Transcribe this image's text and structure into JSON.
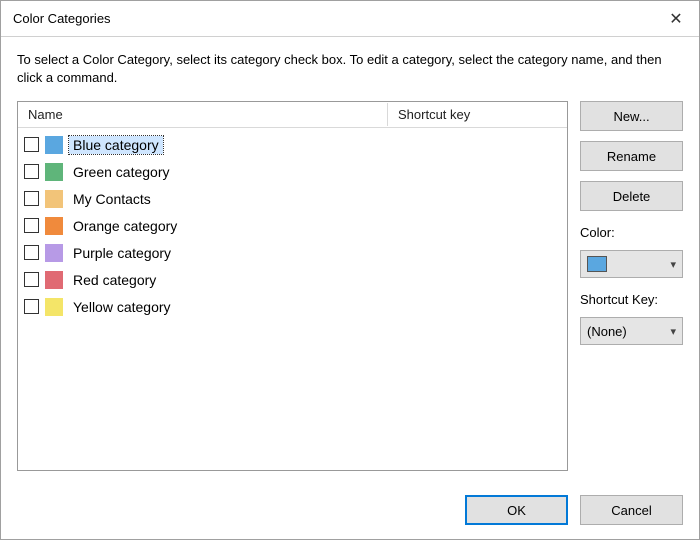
{
  "window": {
    "title": "Color Categories"
  },
  "intro": "To select a Color Category, select its category check box.  To edit a category, select the category name, and then click a command.",
  "list": {
    "columns": {
      "name": "Name",
      "shortcut": "Shortcut key"
    },
    "items": [
      {
        "label": "Blue category",
        "color": "#5aa7e0",
        "selected": true
      },
      {
        "label": "Green category",
        "color": "#5fb57a",
        "selected": false
      },
      {
        "label": "My Contacts",
        "color": "#f2c479",
        "selected": false
      },
      {
        "label": "Orange category",
        "color": "#f08a3c",
        "selected": false
      },
      {
        "label": "Purple category",
        "color": "#b79ae6",
        "selected": false
      },
      {
        "label": "Red category",
        "color": "#e06a73",
        "selected": false
      },
      {
        "label": "Yellow category",
        "color": "#f4e568",
        "selected": false
      }
    ]
  },
  "side": {
    "new_label": "New...",
    "rename_label": "Rename",
    "delete_label": "Delete",
    "color_label": "Color:",
    "color_value": "#5aa7e0",
    "shortcut_label": "Shortcut Key:",
    "shortcut_value": "(None)"
  },
  "footer": {
    "ok_label": "OK",
    "cancel_label": "Cancel"
  }
}
